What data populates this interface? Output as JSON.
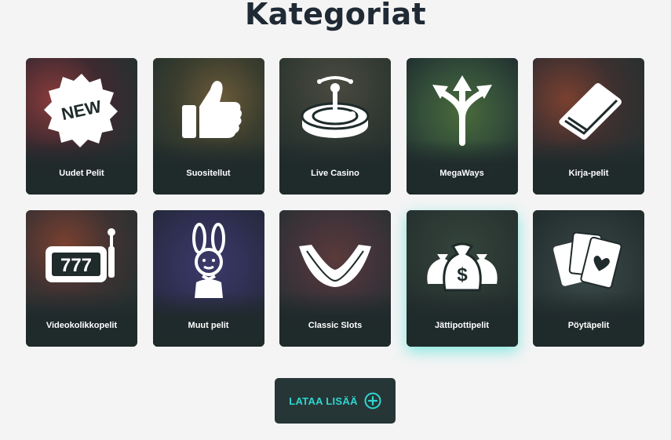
{
  "page": {
    "title": "Kategoriat"
  },
  "categories": [
    {
      "label": "Uudet Pelit",
      "icon": "new-badge-icon"
    },
    {
      "label": "Suositellut",
      "icon": "thumbs-up-icon"
    },
    {
      "label": "Live Casino",
      "icon": "roulette-wheel-icon"
    },
    {
      "label": "MegaWays",
      "icon": "three-arrows-icon"
    },
    {
      "label": "Kirja-pelit",
      "icon": "book-icon"
    },
    {
      "label": "Videokolikkopelit",
      "icon": "slot-machine-icon"
    },
    {
      "label": "Muut pelit",
      "icon": "bunny-mascot-icon"
    },
    {
      "label": "Classic Slots",
      "icon": "boomerang-icon"
    },
    {
      "label": "Jättipottipelit",
      "icon": "money-bags-icon"
    },
    {
      "label": "Pöytäpelit",
      "icon": "playing-cards-icon"
    }
  ],
  "icon_text": {
    "new_badge": "NEW",
    "slot_reels": "777",
    "money_sign": "$"
  },
  "load_more": {
    "label": "LATAA LISÄÄ",
    "icon": "plus-circle-icon"
  },
  "colors": {
    "accent": "#2fd6cf",
    "card_bg": "#1f2a2b",
    "title": "#1f2a35"
  }
}
